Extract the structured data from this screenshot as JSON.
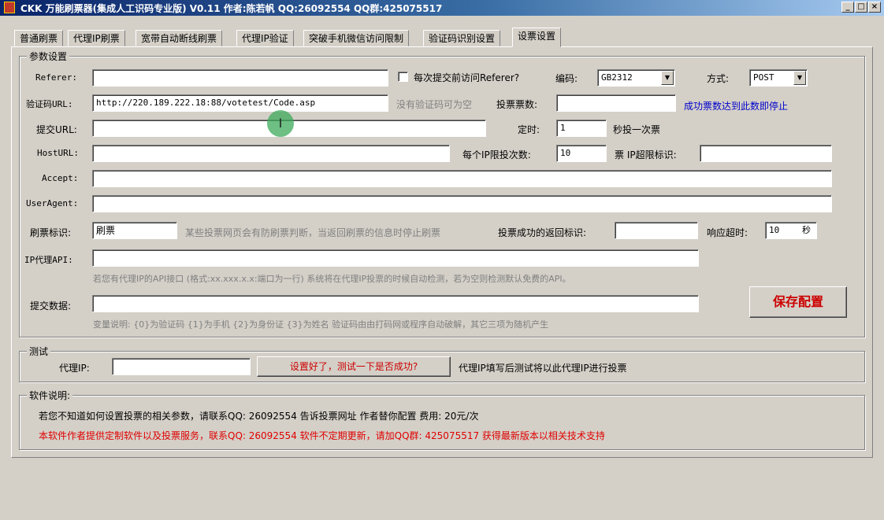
{
  "window": {
    "title": "CKK 万能刷票器(集成人工识码专业版) V0.11 作者:陈若帆 QQ:26092554 QQ群:425075517",
    "controls": {
      "minimize": "_",
      "maximize": "□",
      "close": "×"
    }
  },
  "tabs": [
    {
      "label": "普通刷票"
    },
    {
      "label": "代理IP刷票"
    },
    {
      "label": "宽带自动断线刷票"
    },
    {
      "label": "代理IP验证"
    },
    {
      "label": "突破手机微信访问限制"
    },
    {
      "label": "验证码识别设置"
    },
    {
      "label": "设票设置",
      "active": true
    }
  ],
  "params": {
    "legend": "参数设置",
    "referer_label": "Referer:",
    "referer_value": "",
    "referer_checkbox_label": "每次提交前访问Referer?",
    "encoding_label": "编码:",
    "encoding_value": "GB2312",
    "method_label": "方式:",
    "method_value": "POST",
    "captcha_url_label": "验证码URL:",
    "captcha_url_value": "http://220.189.222.18:88/votetest/Code.asp",
    "captcha_hint": "没有验证码可为空",
    "vote_count_label": "投票票数:",
    "vote_count_value": "",
    "vote_count_hint": "成功票数达到此数即停止",
    "submit_url_label": "提交URL:",
    "submit_url_value": "",
    "timer_label": "定时:",
    "timer_value": "1",
    "timer_unit": "秒投一次票",
    "host_url_label": "HostURL:",
    "host_url_value": "",
    "per_ip_label": "每个IP限投次数:",
    "per_ip_value": "10",
    "per_ip_unit": "票 IP超限标识:",
    "ip_limit_value": "",
    "accept_label": "Accept:",
    "accept_value": "",
    "useragent_label": "UserAgent:",
    "useragent_value": "",
    "mark_label": "刷票标识:",
    "mark_value": "刷票",
    "mark_hint": "某些投票网页会有防刷票判断，当返回刷票的信息时停止刷票",
    "success_label": "投票成功的返回标识:",
    "success_value": "",
    "timeout_label": "响应超时:",
    "timeout_value": "10",
    "timeout_unit": "秒",
    "proxy_api_label": "IP代理API:",
    "proxy_api_value": "",
    "proxy_api_hint": "若您有代理IP的API接口 (格式:xx.xxx.x.x:端口为一行) 系统将在代理IP投票的时候自动检测，若为空则检测默认免费的API。",
    "submit_data_label": "提交数据:",
    "submit_data_value": "",
    "submit_data_hint": "变量说明: {0}为验证码 {1}为手机 {2}为身份证 {3}为姓名 验证码由由打码网或程序自动破解，其它三项为随机产生",
    "save_button": "保存配置"
  },
  "test": {
    "legend": "测试",
    "proxy_label": "代理IP:",
    "proxy_value": "",
    "test_button": "设置好了，测试一下是否成功?",
    "hint": "代理IP填写后测试将以此代理IP进行投票"
  },
  "about": {
    "legend": "软件说明:",
    "line1": "若您不知道如何设置投票的相关参数，请联系QQ: 26092554 告诉投票网址 作者替你配置 费用: 20元/次",
    "line2": "本软件作者提供定制软件以及投票服务，联系QQ: 26092554 软件不定期更新，请加QQ群: 425075517 获得最新版本以相关技术支持"
  },
  "cursor": {
    "glyph": "I"
  },
  "colors": {
    "hint_blue": "#0000cc",
    "warning_red": "#e00000",
    "save_red": "#cc0000"
  }
}
